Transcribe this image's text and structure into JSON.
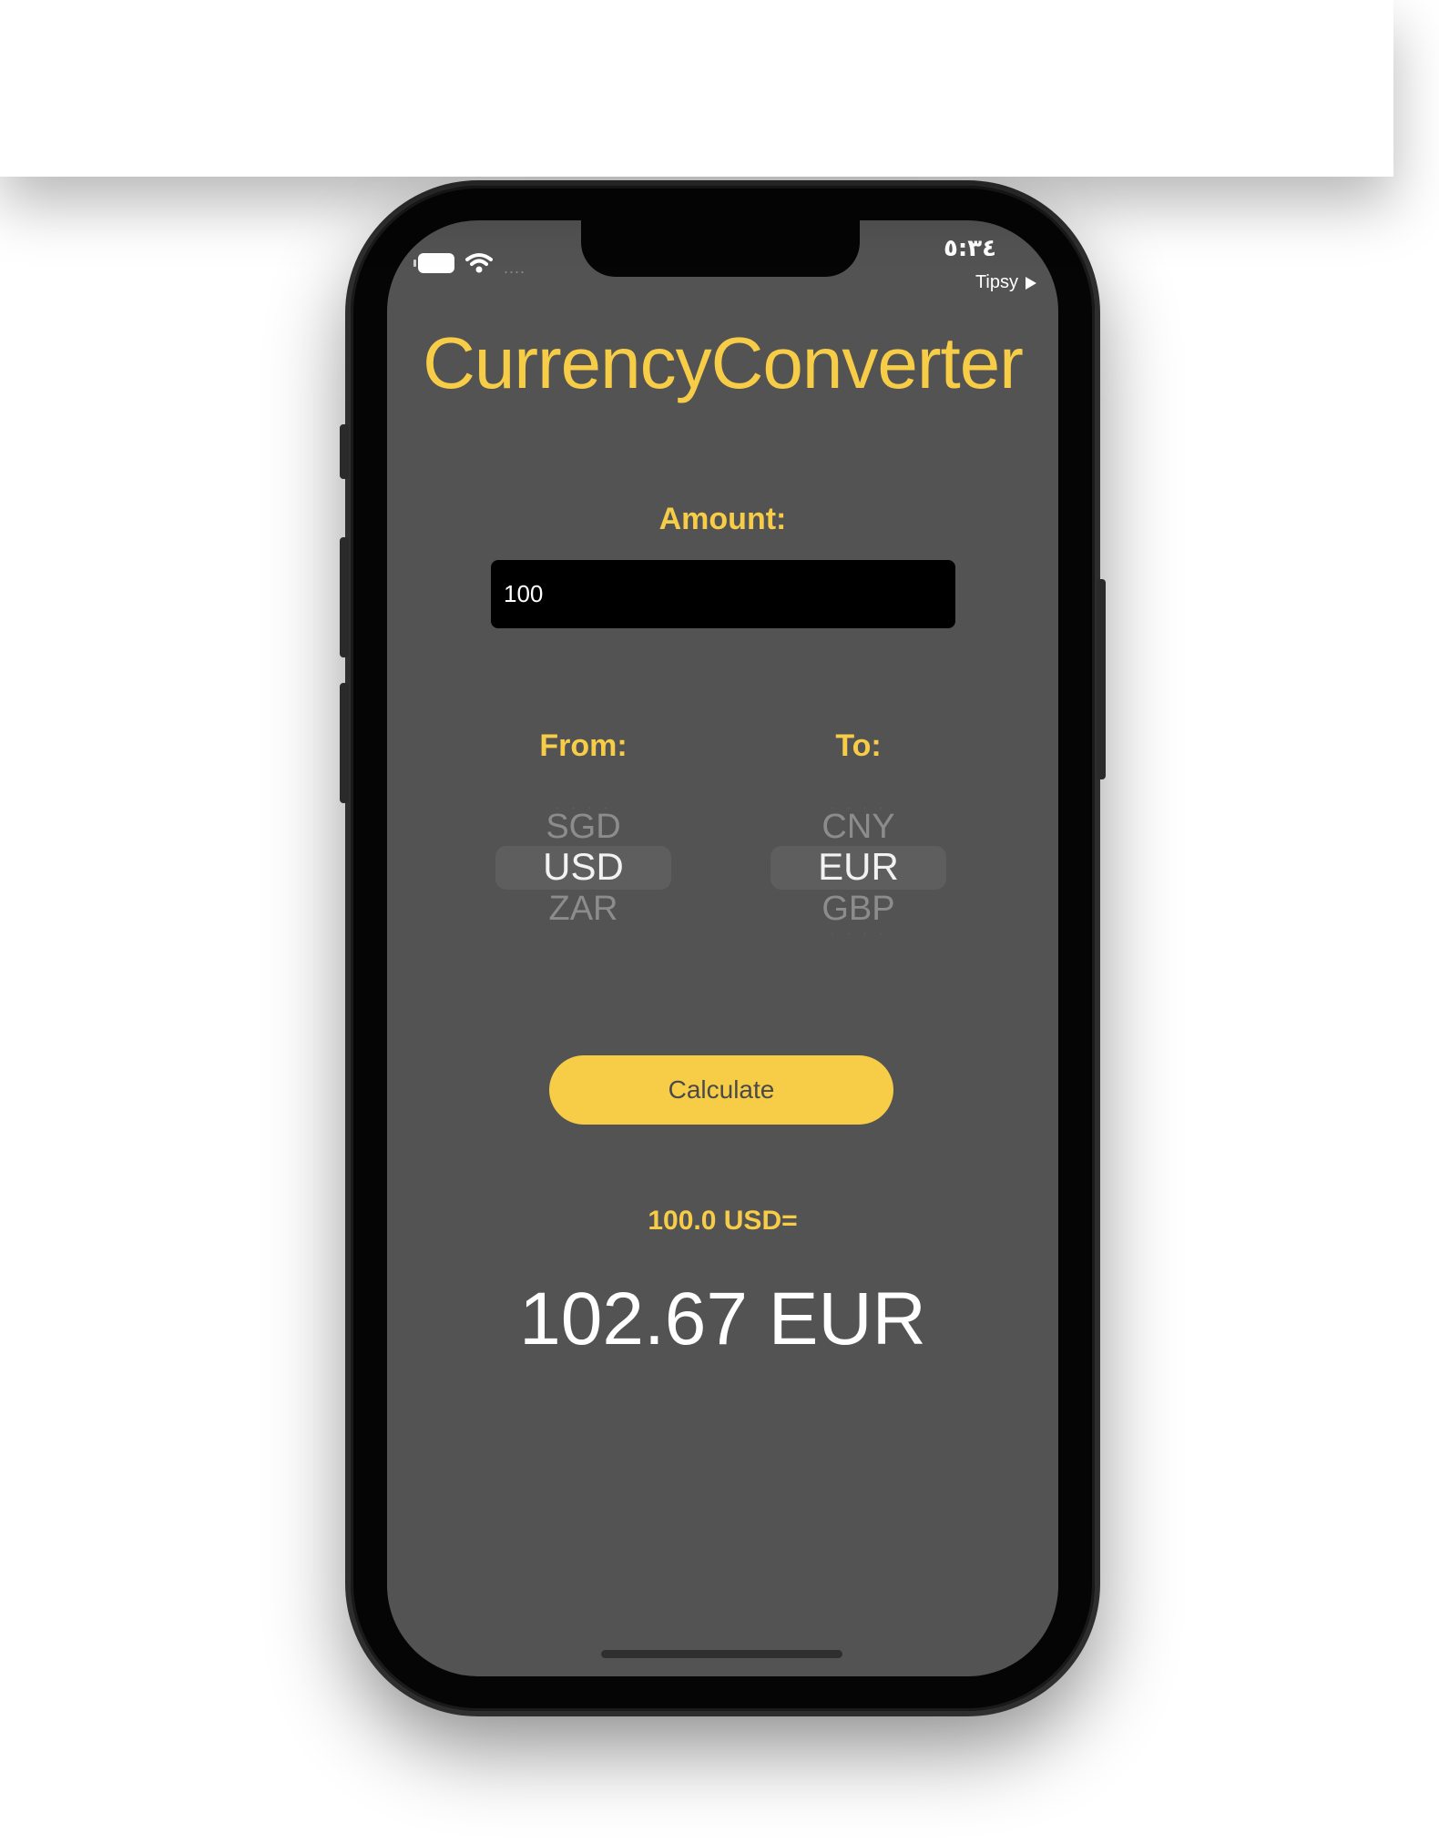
{
  "status_bar": {
    "time": "٥:٣٤",
    "back_app": "Tipsy",
    "signal": "...."
  },
  "app": {
    "title": "CurrencyConverter",
    "accent_color": "#f7cd47",
    "background_color": "#535353"
  },
  "amount": {
    "label": "Amount:",
    "value": "100"
  },
  "from_picker": {
    "label": "From:",
    "items": [
      "SGD",
      "USD",
      "ZAR"
    ],
    "selected": "USD"
  },
  "to_picker": {
    "label": "To:",
    "items": [
      "CNY",
      "EUR",
      "GBP"
    ],
    "selected": "EUR"
  },
  "calculate_button": {
    "label": "Calculate"
  },
  "result": {
    "prefix": "100.0 USD=",
    "value": "102.67 EUR"
  },
  "icons": {
    "battery": "battery-icon",
    "wifi": "wifi-icon",
    "back": "play-icon"
  }
}
